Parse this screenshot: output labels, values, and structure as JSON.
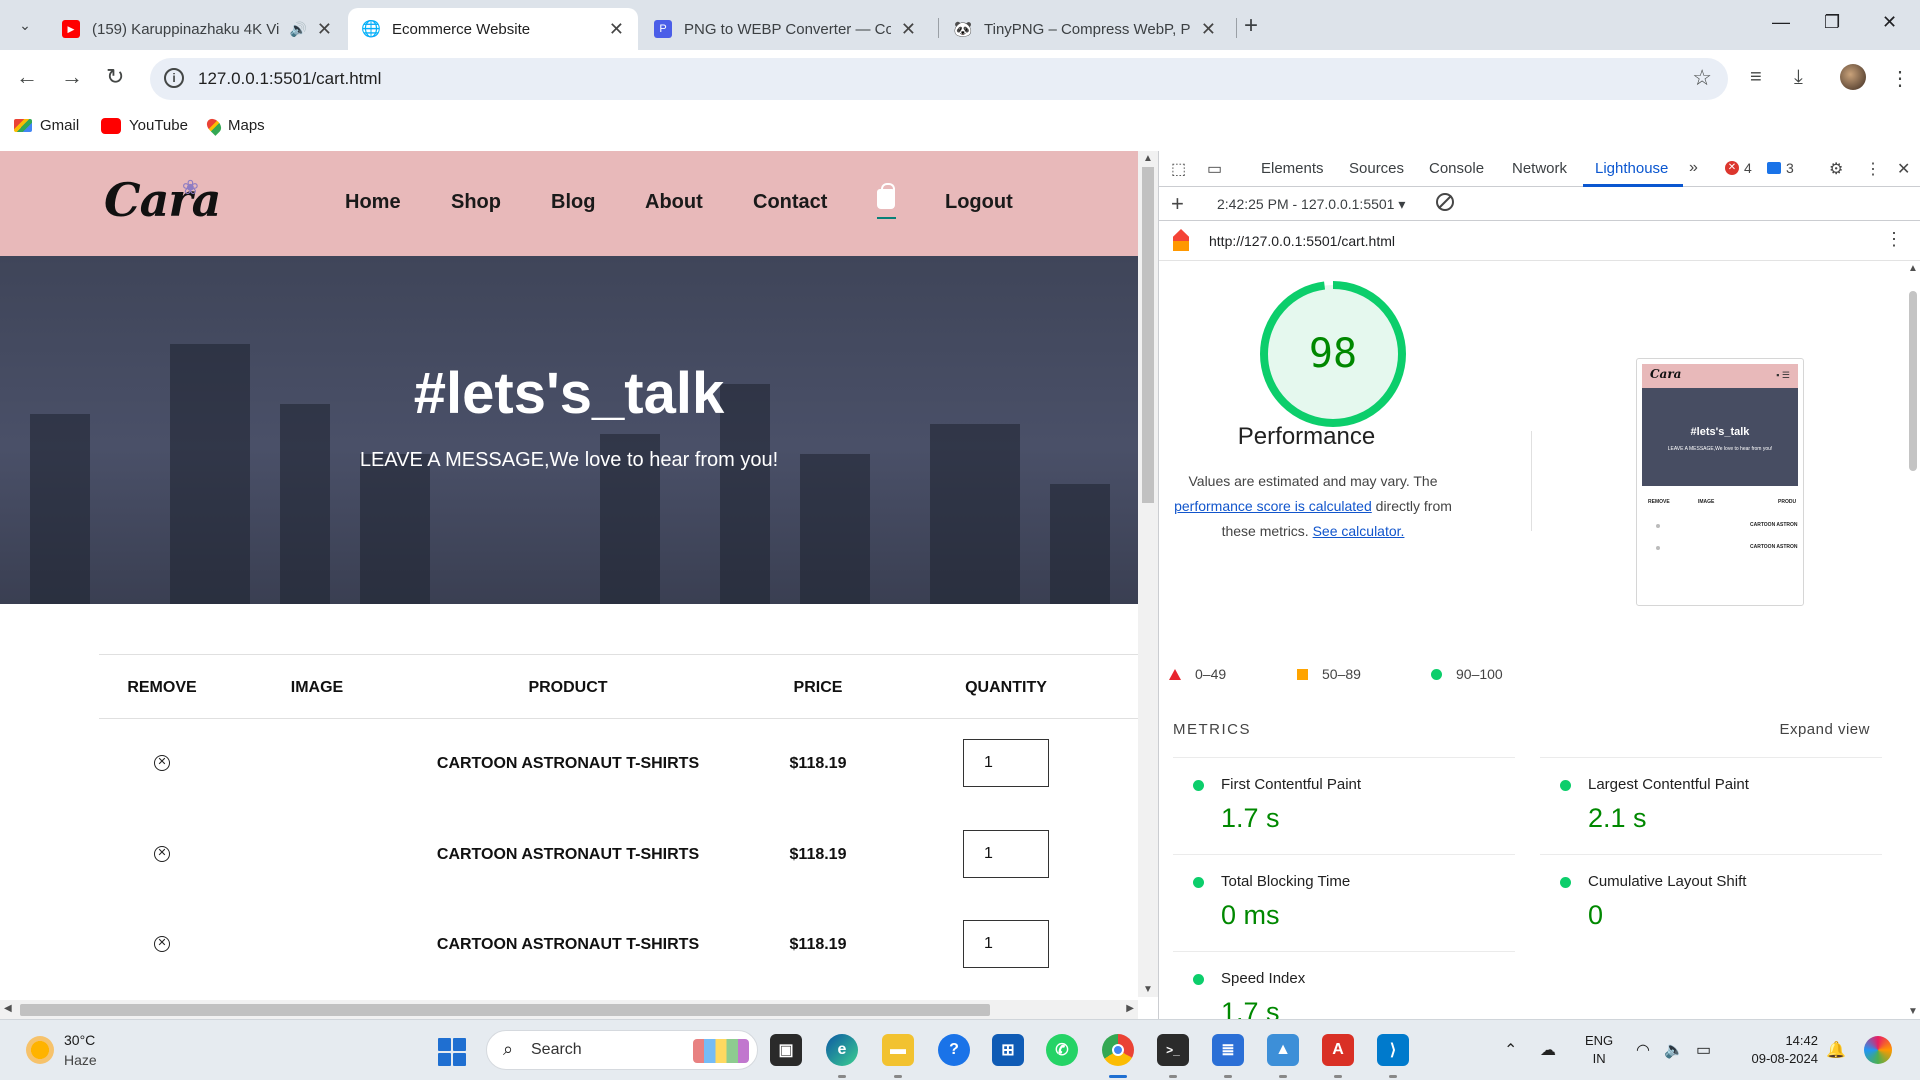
{
  "tabs": [
    {
      "title": "(159) Karuppinazhaku 4K Vi",
      "icon": "youtube-icon"
    },
    {
      "title": "Ecommerce Website",
      "icon": "globe-icon"
    },
    {
      "title": "PNG to WEBP Converter — Con",
      "icon": "converter-icon"
    },
    {
      "title": "TinyPNG – Compress WebP, PN",
      "icon": "panda-icon"
    }
  ],
  "address": {
    "url": "127.0.0.1:5501/cart.html"
  },
  "bookmarks": [
    {
      "label": "Gmail",
      "icon": "gmail-icon"
    },
    {
      "label": "YouTube",
      "icon": "youtube-icon"
    },
    {
      "label": "Maps",
      "icon": "maps-icon"
    }
  ],
  "site": {
    "logo": "Cara",
    "nav": [
      "Home",
      "Shop",
      "Blog",
      "About",
      "Contact",
      "Logout"
    ],
    "hero_title": "#lets's_talk",
    "hero_subtitle": "LEAVE A MESSAGE,We love to hear from you!",
    "table_headers": [
      "REMOVE",
      "IMAGE",
      "PRODUCT",
      "PRICE",
      "QUANTITY"
    ],
    "rows": [
      {
        "product": "CARTOON ASTRONAUT T-SHIRTS",
        "price": "$118.19",
        "quantity": "1"
      },
      {
        "product": "CARTOON ASTRONAUT T-SHIRTS",
        "price": "$118.19",
        "quantity": "1"
      },
      {
        "product": "CARTOON ASTRONAUT T-SHIRTS",
        "price": "$118.19",
        "quantity": "1"
      }
    ]
  },
  "devtools": {
    "tabs": [
      "Elements",
      "Sources",
      "Console",
      "Network",
      "Lighthouse"
    ],
    "active_tab": "Lighthouse",
    "errors": "4",
    "messages": "3",
    "report_selector": "2:42:25 PM - 127.0.0.1:5501",
    "report_url": "http://127.0.0.1:5501/cart.html",
    "score": "98",
    "score_fraction": 0.98,
    "category": "Performance",
    "desc_1": "Values are estimated and may vary. The",
    "desc_link_1": "performance score is calculated",
    "desc_2": " directly from these metrics.",
    "desc_link_2": "See calculator.",
    "legend": [
      "0–49",
      "50–89",
      "90–100"
    ],
    "thumb": {
      "logo": "Cara",
      "hero_title": "#lets's_talk",
      "hero_subtitle": "LEAVE A MESSAGE,We love to hear from you!",
      "headers": [
        "REMOVE",
        "IMAGE",
        "PRODU"
      ],
      "rows": [
        "CARTOON ASTRON",
        "CARTOON ASTRON"
      ]
    },
    "metrics_title": "METRICS",
    "expand_label": "Expand view",
    "metrics": [
      {
        "label": "First Contentful Paint",
        "value": "1.7 s"
      },
      {
        "label": "Largest Contentful Paint",
        "value": "2.1 s"
      },
      {
        "label": "Total Blocking Time",
        "value": "0 ms"
      },
      {
        "label": "Cumulative Layout Shift",
        "value": "0"
      },
      {
        "label": "Speed Index",
        "value": "1.7 s"
      }
    ],
    "colors": {
      "pass": "#0cce6b",
      "pass_text": "#008800",
      "gauge_bg": "#e5f8ee"
    }
  },
  "taskbar": {
    "temp": "30°C",
    "weather": "Haze",
    "search": "Search",
    "lang_1": "ENG",
    "lang_2": "IN",
    "time": "14:42",
    "date": "09-08-2024"
  }
}
